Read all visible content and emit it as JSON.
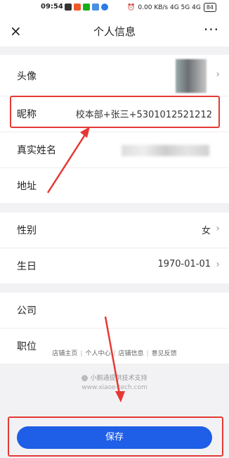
{
  "status": {
    "time": "09:54",
    "right": "0.00 KB/s  4G  5G  4G",
    "battery": "84"
  },
  "navbar": {
    "close": "×",
    "title": "个人信息",
    "more": "···"
  },
  "rows": {
    "avatar": {
      "label": "头像",
      "chevron": "›"
    },
    "nickname": {
      "label": "昵称",
      "value": "校本部+张三+5301012521212"
    },
    "realname": {
      "label": "真实姓名"
    },
    "address": {
      "label": "地址"
    },
    "gender": {
      "label": "性别",
      "value": "女",
      "chevron": "›"
    },
    "birthday": {
      "label": "生日",
      "value": "1970-01-01",
      "chevron": "›"
    },
    "company": {
      "label": "公司"
    },
    "position": {
      "label": "职位"
    }
  },
  "footer": {
    "links": [
      "店铺主页",
      "个人中心",
      "店铺信息",
      "意见反馈"
    ],
    "brand": "小鹅通提供技术支持",
    "url": "www.xiaoe-tech.com"
  },
  "save_label": "保存",
  "colors": {
    "accent": "#1f5ee6",
    "annotation": "#e53935"
  }
}
